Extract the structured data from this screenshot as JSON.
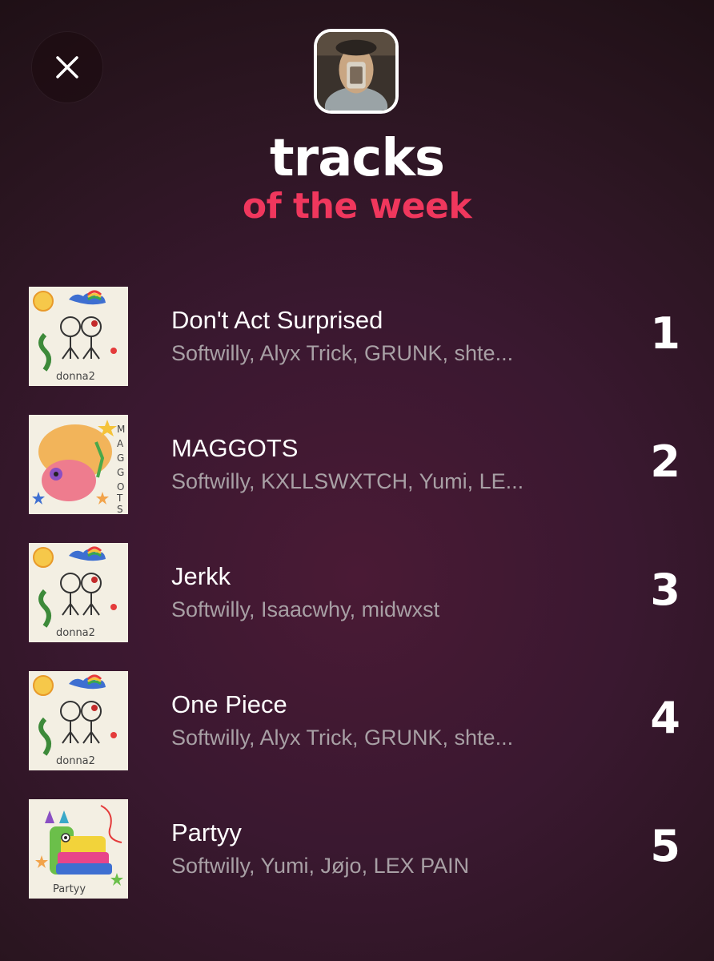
{
  "header": {
    "title": "tracks",
    "subtitle": "of the week",
    "close_icon": "close-icon",
    "accent_color": "#f0375d"
  },
  "tracks": [
    {
      "rank": "1",
      "title": "Don't Act Surprised",
      "artists": "Softwilly, Alyx Trick, GRUNK, shte...",
      "cover_text": "donna2"
    },
    {
      "rank": "2",
      "title": "MAGGOTS",
      "artists": "Softwilly, KXLLSWXTCH, Yumi, LE...",
      "cover_text": "MAGGOTS"
    },
    {
      "rank": "3",
      "title": "Jerkk",
      "artists": "Softwilly, Isaacwhy, midwxst",
      "cover_text": "donna2"
    },
    {
      "rank": "4",
      "title": "One Piece",
      "artists": "Softwilly, Alyx Trick, GRUNK, shte...",
      "cover_text": "donna2"
    },
    {
      "rank": "5",
      "title": "Partyy",
      "artists": "Softwilly, Yumi, Jøjo, LEX PAIN",
      "cover_text": "Partyy"
    }
  ]
}
